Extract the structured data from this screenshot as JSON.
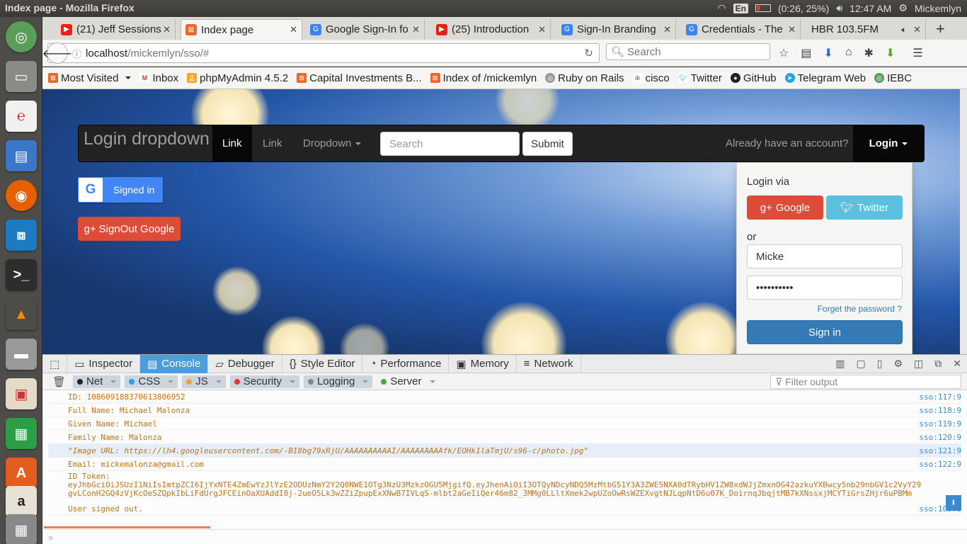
{
  "window": {
    "title": "Index page - Mozilla Firefox",
    "tray": {
      "lang": "En",
      "battery": "(0:26, 25%)",
      "time": "12:47 AM",
      "user": "Mickemlyn"
    }
  },
  "tabs": [
    {
      "label": "(21) Jeff Sessions",
      "icon": "youtube-icon",
      "color": "#e62117"
    },
    {
      "label": "Index page",
      "icon": "page-icon",
      "color": "#e8692b"
    },
    {
      "label": "Google Sign-In fo",
      "icon": "google-icon",
      "color": "#3b82f6"
    },
    {
      "label": "(25) Introduction",
      "icon": "youtube-icon",
      "color": "#e62117"
    },
    {
      "label": "Sign-In Branding",
      "icon": "google-icon",
      "color": "#3b82f6"
    },
    {
      "label": "Credentials - The",
      "icon": "google-icon",
      "color": "#3b82f6"
    },
    {
      "label": "HBR 103.5FM",
      "icon": "radio-icon",
      "color": "#888"
    }
  ],
  "nav": {
    "url_host": "localhost",
    "url_path": "/mickemlyn/sso/#",
    "search_placeholder": "Search"
  },
  "bookmarks": [
    "Most Visited",
    "Inbox",
    "phpMyAdmin 4.5.2",
    "Capital Investments B...",
    "Index of /mickemlyn",
    "Ruby on Rails",
    "cisco",
    "Twitter",
    "GitHub",
    "Telegram Web",
    "IEBC"
  ],
  "site": {
    "brand": "Login dropdown",
    "links": [
      "Link",
      "Link",
      "Dropdown"
    ],
    "search_placeholder": "Search",
    "submit": "Submit",
    "account_text": "Already have an account?",
    "login": "Login",
    "signed_in": "Signed in",
    "signout": "SignOut Google",
    "dropdown": {
      "login_via": "Login via",
      "google": "Google",
      "twitter": "Twitter",
      "or": "or",
      "username": "Micke",
      "password": "••••••••••",
      "forgot": "Forget the password ?",
      "signin": "Sign in"
    }
  },
  "devtools": {
    "tabs": [
      "Inspector",
      "Console",
      "Debugger",
      "Style Editor",
      "Performance",
      "Memory",
      "Network"
    ],
    "filters": [
      "Net",
      "CSS",
      "JS",
      "Security",
      "Logging",
      "Server"
    ],
    "filter_output": "Filter output",
    "log": [
      {
        "text": "ID: 108609188370613806952",
        "src": "sso:117:9"
      },
      {
        "text": "Full Name: Michael Malonza",
        "src": "sso:118:9"
      },
      {
        "text": "Given Name: Michael",
        "src": "sso:119:9"
      },
      {
        "text": "Family Name: Malonza",
        "src": "sso:120:9"
      },
      {
        "text": "\"Image URL: https://lh4.googleusercontent.com/-BI8bg79xRjU/AAAAAAAAAAI/AAAAAAAAAfk/EOHk1laTmjU/s96-c/photo.jpg\"",
        "src": "sso:121:9"
      },
      {
        "text": "Email: mickemalonza@gmail.com",
        "src": "sso:122:9"
      }
    ],
    "id_token_label": "ID Token:",
    "id_token_line1": "eyJhbGciOiJSUzI1NiIsImtpZCI6IjYxNTE4ZmEwYzJlYzE2ODUzNmY2Y2Q0NWE1OTg3NzU3MzkzOGU5MjgifQ.eyJhenAiOiI3OTQyNDcyNDQ5MzMtbG51Y3A3ZWE5NXA0dTRybHV1ZW8xdWJjZmxnOG42azkuYXBwcy5nb29nbGV1c2VyY29",
    "id_token_line2": "gvLConH2GQ4zVjKcOeSZQpkIbLiFdUrgJFCEinOaXUAddI8j-2ueO5Lk3wZZiZpupExXNwB7IVLqS-mlbt2aGeIiQer46m82_3MMg0LLltXmek2wpUZoOwRsWZEXvgtNJLqpNtD6u07K_DoirnqJbqjtMB7kXNssxjMCYTiGrsZHjr6uPBMm",
    "signed_out": "User signed out.",
    "signed_out_src": "sso:109:9"
  }
}
